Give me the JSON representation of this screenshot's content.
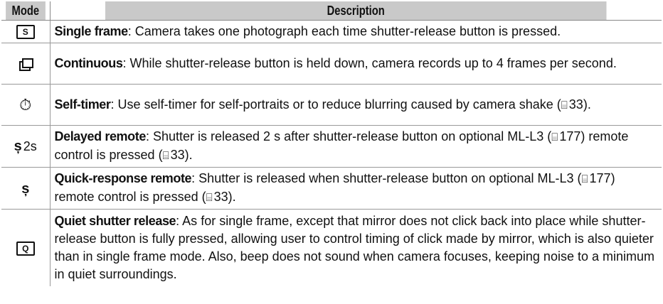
{
  "header": {
    "mode": "Mode",
    "description": "Description"
  },
  "rows": [
    {
      "icon": "single-frame-icon",
      "icon_text": "S",
      "term": "Single frame",
      "body": ": Camera takes one photograph each time shutter-release button is pressed."
    },
    {
      "icon": "continuous-icon",
      "term": "Continuous",
      "body": ": While shutter-release button is held down, camera records up to 4 frames per second."
    },
    {
      "icon": "self-timer-icon",
      "icon_text": "⏱",
      "term": "Self-timer",
      "body_pre": ": Use self-timer for self-portraits or to reduce blurring caused by camera shake (",
      "ref1": "33",
      "body_post": ")."
    },
    {
      "icon": "delayed-remote-icon",
      "icon_text": "ș",
      "icon_suffix": "2s",
      "term": "Delayed remote",
      "body_pre": ": Shutter is released 2 s after shutter-release button on optional ML-L3 (",
      "ref1": "177",
      "body_mid": ") remote control is pressed (",
      "ref2": "33",
      "body_post": ")."
    },
    {
      "icon": "quick-remote-icon",
      "icon_text": "ș",
      "term": "Quick-response remote",
      "body_pre": ": Shutter is released when shutter-release button on optional ML-L3 (",
      "ref1": "177",
      "body_mid": ") remote control is pressed (",
      "ref2": "33",
      "body_post": ")."
    },
    {
      "icon": "quiet-shutter-icon",
      "icon_text": "Q",
      "term": "Quiet shutter release",
      "body": ": As for single frame, except that mirror does not click back into place while shutter-release button is fully pressed, allowing user to control timing of click made by mirror, which is also quieter than in single frame mode.  Also, beep does not sound when camera focuses, keeping noise to a minimum in quiet surroundings."
    }
  ],
  "ref_glyph": "⌸"
}
